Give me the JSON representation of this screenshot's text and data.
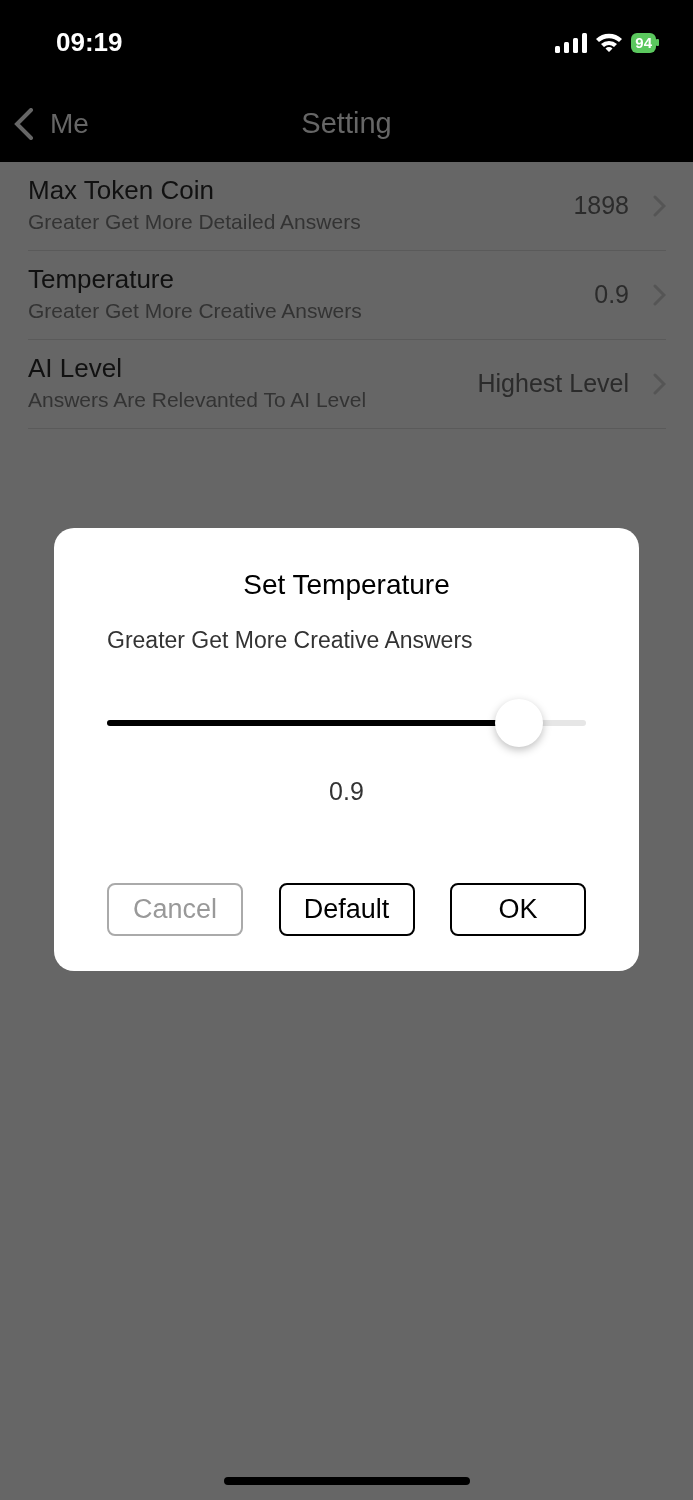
{
  "status_bar": {
    "time": "09:19",
    "battery": "94"
  },
  "nav": {
    "back": "Me",
    "title": "Setting"
  },
  "settings": [
    {
      "title": "Max Token Coin",
      "subtitle": "Greater Get More Detailed Answers",
      "value": "1898"
    },
    {
      "title": "Temperature",
      "subtitle": "Greater Get More Creative Answers",
      "value": "0.9"
    },
    {
      "title": "AI Level",
      "subtitle": "Answers Are Relevanted To AI Level",
      "value": "Highest Level"
    }
  ],
  "dialog": {
    "title": "Set Temperature",
    "subtitle": "Greater Get More Creative Answers",
    "slider": {
      "level": 0.86
    },
    "reading": "0.9",
    "buttons": [
      {
        "label": "Cancel",
        "disabled": true
      },
      {
        "label": "Default",
        "disabled": false
      },
      {
        "label": "OK",
        "disabled": false
      }
    ]
  }
}
